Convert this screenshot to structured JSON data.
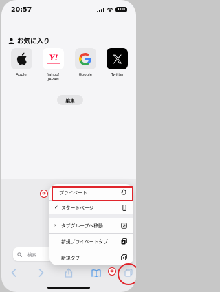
{
  "status": {
    "time": "20:57",
    "battery": "100"
  },
  "favorites": {
    "title": "お気に入り",
    "items": [
      {
        "label": "Apple",
        "icon": "apple-logo-icon"
      },
      {
        "label": "Yahoo!\nJAPAN",
        "icon": "yahoo-japan-logo-icon"
      },
      {
        "label": "Google",
        "icon": "google-logo-icon"
      },
      {
        "label": "Twitter",
        "icon": "x-logo-icon"
      }
    ],
    "edit_label": "編集"
  },
  "search": {
    "placeholder": "検索"
  },
  "tab_menu": {
    "items": [
      {
        "label": "プライベート",
        "icon": "hand-icon",
        "checked": false
      },
      {
        "label": "スタートページ",
        "icon": "phone-icon",
        "checked": true
      },
      {
        "label": "タブグループへ移動",
        "icon": "move-arrow-icon"
      },
      {
        "label": "新規プライベートタブ",
        "icon": "private-tab-icon"
      },
      {
        "label": "新規タブ",
        "icon": "new-tab-icon"
      }
    ]
  },
  "annotations": {
    "step1": "①",
    "step2": "②",
    "highlight_color": "#e0262c"
  },
  "colors": {
    "toolbar_blue": "#5aa0ee",
    "accent_red": "#e0262c"
  }
}
